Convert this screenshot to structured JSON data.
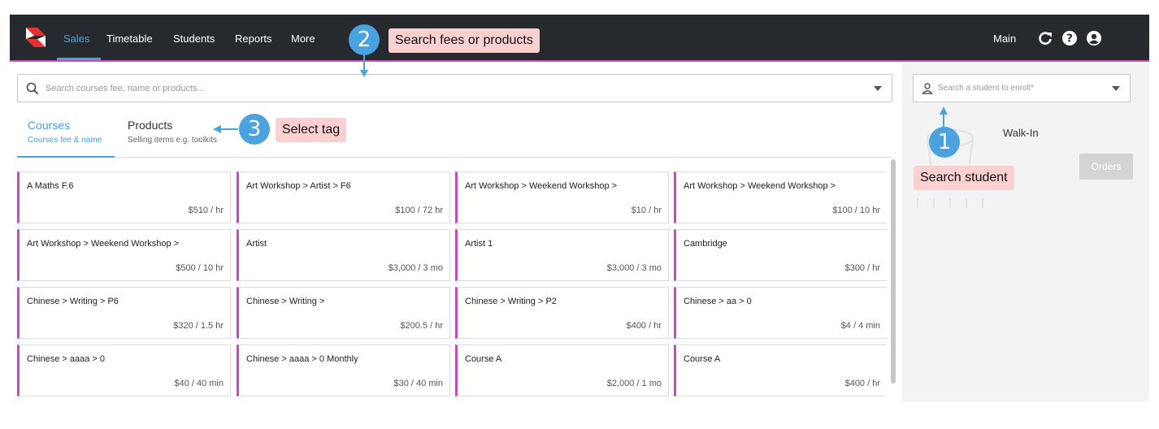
{
  "nav": {
    "items": [
      "Sales",
      "Timetable",
      "Students",
      "Reports",
      "More"
    ],
    "active": "Sales",
    "branch": "Main",
    "icons": [
      "refresh-icon",
      "help-icon",
      "account-icon"
    ]
  },
  "search": {
    "placeholder": "Search courses fee, name or products..."
  },
  "tabs": [
    {
      "title": "Courses",
      "subtitle": "Courses fee & name"
    },
    {
      "title": "Products",
      "subtitle": "Selling items e.g. toolkits"
    }
  ],
  "courses": [
    {
      "name": "A Maths F.6",
      "price": "$510 / hr"
    },
    {
      "name": "Art Workshop > Artist > F6",
      "price": "$100 / 72 hr"
    },
    {
      "name": "Art Workshop > Weekend Workshop >",
      "price": "$10 / hr"
    },
    {
      "name": "Art Workshop > Weekend Workshop >",
      "price": "$100 / 10 hr"
    },
    {
      "name": "Art Workshop > Weekend Workshop >",
      "price": "$500 / 10 hr"
    },
    {
      "name": "Artist",
      "price": "$3,000 / 3 mo"
    },
    {
      "name": "Artist 1",
      "price": "$3,000 / 3 mo"
    },
    {
      "name": "Cambridge",
      "price": "$300 / hr"
    },
    {
      "name": "Chinese > Writing > P6",
      "price": "$320 / 1.5 hr"
    },
    {
      "name": "Chinese > Writing >",
      "price": "$200.5 / hr"
    },
    {
      "name": "Chinese > Writing > P2",
      "price": "$400 / hr"
    },
    {
      "name": "Chinese > aa > 0",
      "price": "$4 / 4 min"
    },
    {
      "name": "Chinese > aaaa > 0",
      "price": "$40 / 40 min"
    },
    {
      "name": "Chinese > aaaa > 0 Monthly",
      "price": "$30 / 40 min"
    },
    {
      "name": "Course A",
      "price": "$2,000 / 1 mo"
    },
    {
      "name": "Course A",
      "price": "$400 / hr"
    }
  ],
  "student": {
    "placeholder": "Search a student to enroll*",
    "walkin": "Walk-In",
    "orders_label": "Orders"
  },
  "annotations": [
    {
      "number": "1",
      "label": "Search student"
    },
    {
      "number": "2",
      "label": "Search fees or products"
    },
    {
      "number": "3",
      "label": "Select tag"
    }
  ],
  "colors": {
    "nav_bg": "#262a2e",
    "accent": "#4aa3df",
    "card_border": "#c24cc0",
    "annotation_label_bg": "#fbd0d0"
  }
}
